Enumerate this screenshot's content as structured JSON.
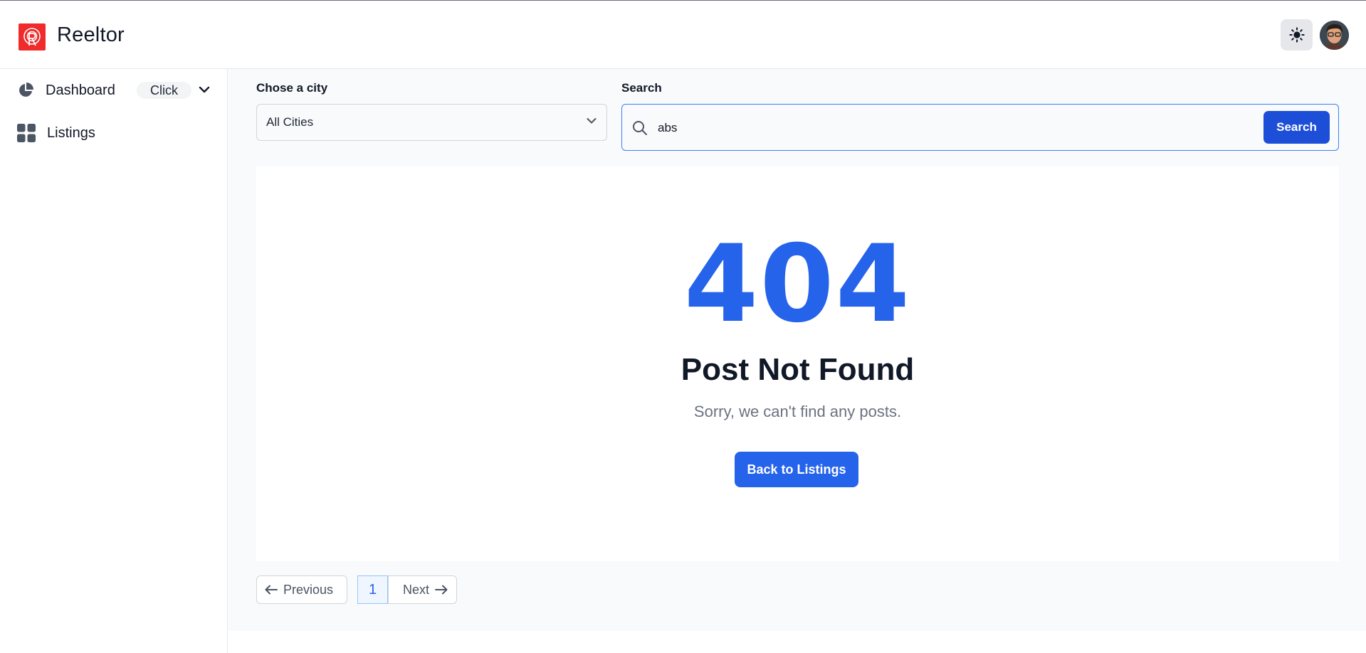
{
  "header": {
    "brand": "Reeltor",
    "theme_toggle_icon": "sun-icon",
    "avatar_icon": "user-avatar"
  },
  "sidebar": {
    "items": [
      {
        "label": "Dashboard",
        "icon": "pie-chart-icon",
        "badge": "Click",
        "chevron": "chevron-down-icon"
      },
      {
        "label": "Listings",
        "icon": "grid-icon"
      }
    ]
  },
  "filters": {
    "city_label": "Chose a city",
    "city_value": "All Cities",
    "search_label": "Search",
    "search_value": "abs",
    "search_button": "Search"
  },
  "empty_state": {
    "code": "404",
    "title": "Post Not Found",
    "message": "Sorry, we can't find any posts.",
    "button": "Back to Listings"
  },
  "pagination": {
    "previous": "Previous",
    "current_page": "1",
    "next": "Next"
  },
  "colors": {
    "accent": "#2563eb",
    "logo": "#ef2b2b"
  }
}
